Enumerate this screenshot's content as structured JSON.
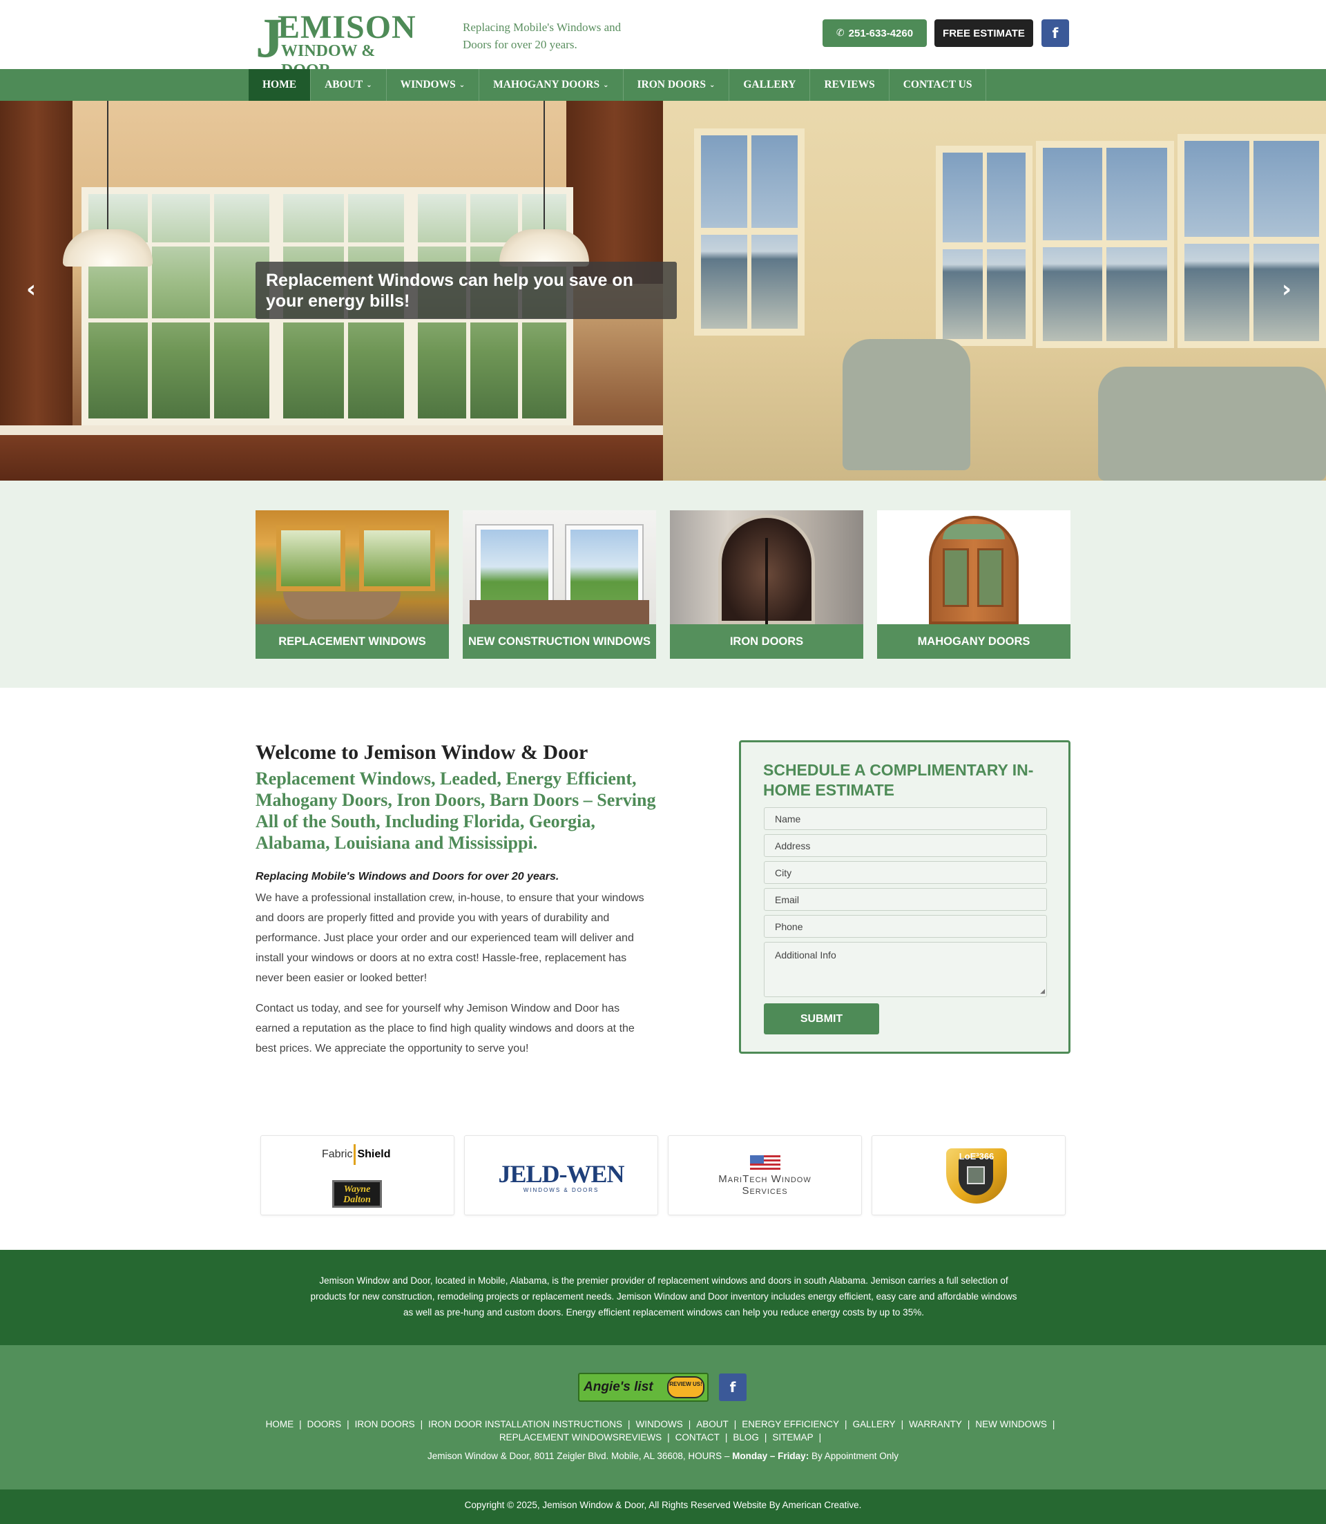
{
  "header": {
    "logo_letter": "J",
    "logo_line1": "EMISON",
    "logo_line2": "WINDOW & DOOR",
    "tagline": "Replacing Mobile's Windows and Doors for over 20 years.",
    "phone": "251-633-4260",
    "estimate_label": "FREE ESTIMATE",
    "facebook_glyph": "f",
    "phone_icon": "phone-icon",
    "facebook_icon": "facebook-icon"
  },
  "nav": {
    "items": [
      {
        "label": "HOME",
        "active": true,
        "dropdown": false
      },
      {
        "label": "ABOUT",
        "active": false,
        "dropdown": true
      },
      {
        "label": "WINDOWS",
        "active": false,
        "dropdown": true
      },
      {
        "label": "MAHOGANY DOORS",
        "active": false,
        "dropdown": true
      },
      {
        "label": "IRON DOORS",
        "active": false,
        "dropdown": true
      },
      {
        "label": "GALLERY",
        "active": false,
        "dropdown": false
      },
      {
        "label": "REVIEWS",
        "active": false,
        "dropdown": false
      },
      {
        "label": "CONTACT US",
        "active": false,
        "dropdown": false
      }
    ],
    "chevron": "⌄"
  },
  "hero": {
    "caption": "Replacement Windows can help you save on your energy bills!",
    "prev_glyph": "‹",
    "next_glyph": "›"
  },
  "tiles": [
    {
      "label": "REPLACEMENT WINDOWS"
    },
    {
      "label": "NEW CONSTRUCTION WINDOWS"
    },
    {
      "label": "IRON DOORS"
    },
    {
      "label": "MAHOGANY DOORS"
    }
  ],
  "welcome": {
    "title": "Welcome to Jemison Window & Door",
    "subtitle": "Replacement Windows, Leaded, Energy Efficient, Mahogany Doors, Iron Doors, Barn Doors – Serving All of the South, Including Florida, Georgia, Alabama, Louisiana and Mississippi.",
    "lead": "Replacing Mobile's Windows and Doors for over 20 years.",
    "p1": "We have a professional installation crew, in-house, to ensure that your windows and doors are properly fitted and provide you with years of durability and performance. Just place your order and our experienced team will deliver and install your windows or doors at no extra cost! Hassle-free, replacement has never been easier or looked better!",
    "p2": "Contact us today, and see for yourself why Jemison Window and Door has earned a reputation as the place to find high quality windows and doors at the best prices. We appreciate the opportunity to serve you!"
  },
  "form": {
    "title": "SCHEDULE A COMPLIMENTARY IN-HOME ESTIMATE",
    "fields": [
      {
        "placeholder": "Name"
      },
      {
        "placeholder": "Address"
      },
      {
        "placeholder": "City"
      },
      {
        "placeholder": "Email"
      },
      {
        "placeholder": "Phone"
      },
      {
        "placeholder": "Additional Info"
      }
    ],
    "submit_label": "SUBMIT"
  },
  "partners": {
    "fabric_shield_pre": "Fabric",
    "fabric_shield_post": "Shield",
    "wayne_dalton": "Wayne Dalton",
    "jeldwen": "JELD-WEN",
    "jeldwen_sub": "WINDOWS & DOORS",
    "maritech_line1": "MariTech Window",
    "maritech_line2": "Services",
    "lowe_label": "LoE³366"
  },
  "footer": {
    "about": "Jemison Window and Door, located in Mobile, Alabama, is the premier provider of replacement windows and doors in south Alabama. Jemison carries a full selection of products for new construction, remodeling projects or replacement needs. Jemison Window and Door inventory includes energy efficient, easy care and affordable windows as well as pre-hung and custom doors. Energy efficient replacement windows can help you reduce energy costs by up to 35%.",
    "angies_text": "Angie's list",
    "angies_badge": "REVIEW US!",
    "facebook_glyph": "f",
    "links": [
      "HOME",
      "DOORS",
      "IRON DOORS",
      "IRON DOOR INSTALLATION INSTRUCTIONS",
      "WINDOWS",
      "ABOUT",
      "ENERGY EFFICIENCY",
      "GALLERY",
      "WARRANTY",
      "NEW WINDOWS",
      "REPLACEMENT WINDOWS",
      "REVIEWS",
      "CONTACT",
      "BLOG",
      "SITEMAP"
    ],
    "address_prefix": "Jemison Window & Door, 8011 Zeigler Blvd. Mobile, AL 36608, HOURS –",
    "hours_days": "Monday – Friday:",
    "hours_value": "By Appointment Only",
    "copyright": "Copyright © 2025, Jemison Window & Door, All Rights Reserved Website By American Creative."
  },
  "colors": {
    "brand_green": "#4e8b57",
    "dark_green": "#266831",
    "nav_active": "#1f5a2c",
    "facebook": "#3b5998"
  }
}
